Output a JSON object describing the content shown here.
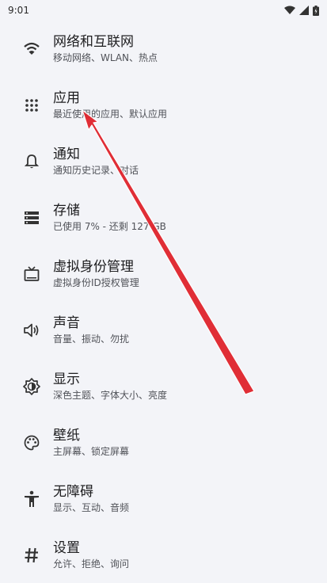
{
  "status_bar": {
    "time": "9:01"
  },
  "settings": {
    "items": [
      {
        "title": "网络和互联网",
        "subtitle": "移动网络、WLAN、热点",
        "icon": "wifi-icon"
      },
      {
        "title": "应用",
        "subtitle": "最近使用的应用、默认应用",
        "icon": "apps-grid-icon"
      },
      {
        "title": "通知",
        "subtitle": "通知历史记录、对话",
        "icon": "bell-icon"
      },
      {
        "title": "存储",
        "subtitle": "已使用 7% - 还剩 127 GB",
        "icon": "storage-icon"
      },
      {
        "title": "虚拟身份管理",
        "subtitle": "虚拟身份ID授权管理",
        "icon": "tv-icon"
      },
      {
        "title": "声音",
        "subtitle": "音量、振动、勿扰",
        "icon": "speaker-icon"
      },
      {
        "title": "显示",
        "subtitle": "深色主题、字体大小、亮度",
        "icon": "brightness-icon"
      },
      {
        "title": "壁纸",
        "subtitle": "主屏幕、锁定屏幕",
        "icon": "palette-icon"
      },
      {
        "title": "无障碍",
        "subtitle": "显示、互动、音频",
        "icon": "accessibility-icon"
      },
      {
        "title": "设置",
        "subtitle": "允许、拒绝、询问",
        "icon": "hash-icon"
      }
    ]
  },
  "colors": {
    "background": "#f3f4f8",
    "annotation_arrow": "#e0242c"
  }
}
